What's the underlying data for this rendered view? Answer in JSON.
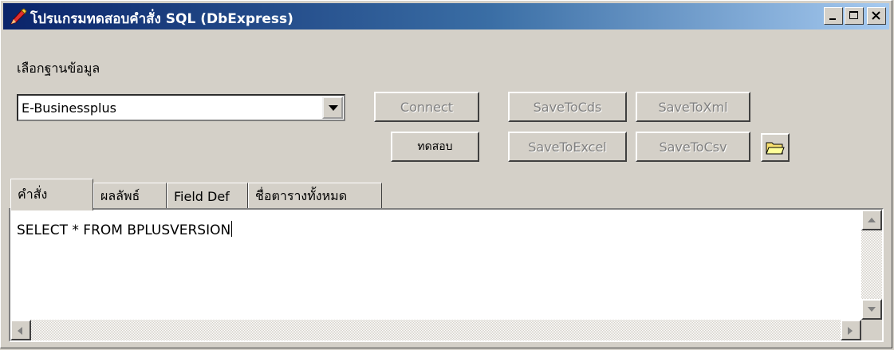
{
  "window": {
    "title": "โปรแกรมทดสอบคำสั่ง SQL (DbExpress)"
  },
  "database": {
    "label": "เลือกฐานข้อมูล",
    "selected": "E-Businessplus"
  },
  "buttons": {
    "connect": "Connect",
    "test": "ทดสอบ",
    "save_to_cds": "SaveToCds",
    "save_to_xml": "SaveToXml",
    "save_to_excel": "SaveToExcel",
    "save_to_csv": "SaveToCsv"
  },
  "tabs": [
    {
      "label": "คำสั่ง"
    },
    {
      "label": "ผลลัพธ์"
    },
    {
      "label": "Field Def"
    },
    {
      "label": "ชื่อตารางทั้งหมด"
    }
  ],
  "editor": {
    "sql": "SELECT * FROM BPLUSVERSION"
  },
  "icons": {
    "app": "pen-icon",
    "open_folder": "folder-open-icon"
  }
}
